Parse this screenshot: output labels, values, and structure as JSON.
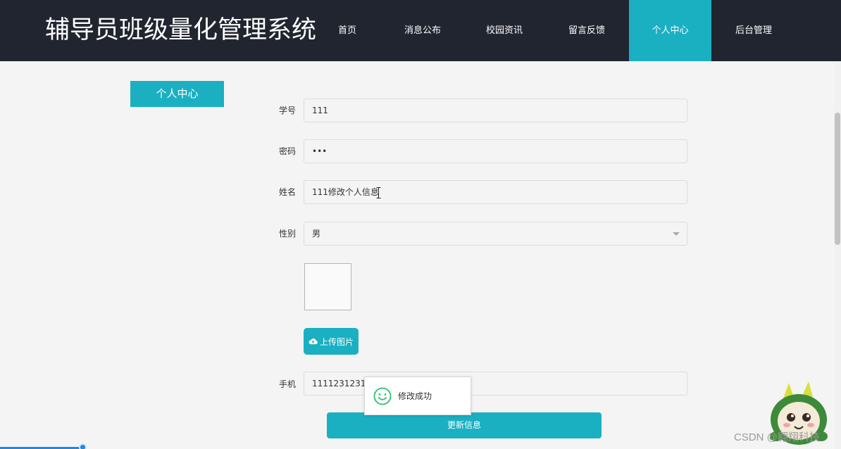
{
  "header": {
    "brand": "辅导员班级量化管理系统",
    "nav": [
      {
        "label": "首页",
        "active": false
      },
      {
        "label": "消息公布",
        "active": false
      },
      {
        "label": "校园资讯",
        "active": false
      },
      {
        "label": "留言反馈",
        "active": false
      },
      {
        "label": "个人中心",
        "active": true
      },
      {
        "label": "后台管理",
        "active": false
      }
    ]
  },
  "sidebar": {
    "title": "个人中心"
  },
  "form": {
    "student_id": {
      "label": "学号",
      "value": "111"
    },
    "password": {
      "label": "密码",
      "value": "•••"
    },
    "name": {
      "label": "姓名",
      "value": "111修改个人信息"
    },
    "gender": {
      "label": "性别",
      "value": "男"
    },
    "upload_button": "上传图片",
    "phone": {
      "label": "手机",
      "value": "11112312312"
    },
    "submit_button": "更新信息"
  },
  "toast": {
    "message": "修改成功"
  },
  "watermark": "CSDN @翱翔科技",
  "colors": {
    "accent": "#1ab0c2",
    "navbar": "#212530",
    "success": "#2fbf71"
  },
  "icons": [
    "cloud-upload-icon",
    "smile-success-icon",
    "chevron-down-icon"
  ]
}
